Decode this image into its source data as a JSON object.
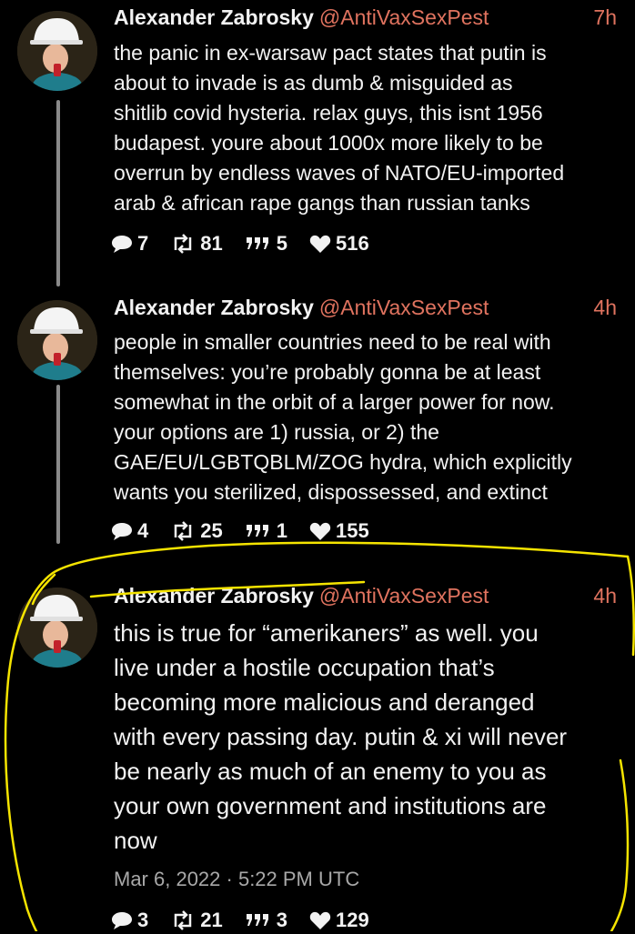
{
  "tweets": [
    {
      "name": "Alexander Zabrosky",
      "handle": "@AntiVaxSexPest",
      "time": "7h",
      "lines": [
        "the panic in ex-warsaw pact states that putin is",
        "about to invade is as dumb & misguided as",
        "shitlib covid hysteria. relax guys, this isnt 1956",
        "budapest. youre about 1000x more likely to be",
        "overrun by endless waves of NATO/EU-imported",
        "arab & african rape gangs than russian tanks"
      ],
      "replies": "7",
      "retweets": "81",
      "quotes": "5",
      "likes": "516"
    },
    {
      "name": "Alexander Zabrosky",
      "handle": "@AntiVaxSexPest",
      "time": "4h",
      "lines": [
        "people in smaller countries need to be real with",
        "themselves: you’re probably gonna be at least",
        "somewhat in the orbit of a larger power for now.",
        "your options are 1) russia, or 2) the",
        "GAE/EU/LGBTQBLM/ZOG hydra, which explicitly",
        "wants you sterilized, dispossessed, and extinct"
      ],
      "replies": "4",
      "retweets": "25",
      "quotes": "1",
      "likes": "155"
    },
    {
      "name": "Alexander Zabrosky",
      "handle": "@AntiVaxSexPest",
      "time": "4h",
      "lines": [
        "this is true for “amerikaners” as well. you",
        "live under a hostile occupation that’s",
        "becoming more malicious and deranged",
        "with every passing day. putin & xi will never",
        "be nearly as much of an enemy to you as",
        "your own government and institutions are",
        "now"
      ],
      "date": "Mar 6, 2022 · 5:22 PM UTC",
      "replies": "3",
      "retweets": "21",
      "quotes": "3",
      "likes": "129"
    }
  ],
  "colors": {
    "background": "#000000",
    "handle": "#e0735f",
    "annotation": "#f5e400",
    "thread_line": "#8a8a8a"
  },
  "icons": {
    "reply": "reply-icon",
    "retweet": "retweet-icon",
    "quote": "quote-icon",
    "like": "heart-icon"
  }
}
